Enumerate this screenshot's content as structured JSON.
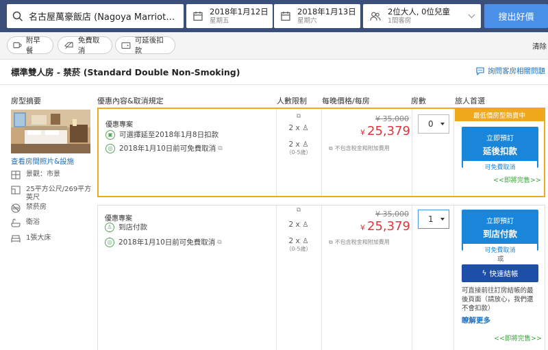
{
  "search": {
    "destination": "名古屋萬豪飯店 (Nagoya Marriott Associa Hotel)",
    "checkin_date": "2018年1月12日",
    "checkin_day": "星期五",
    "checkout_date": "2018年1月13日",
    "checkout_day": "星期六",
    "guests": "2位大人, 0位兒童",
    "rooms": "1間客房",
    "search_button": "搜出好價"
  },
  "filters": {
    "breakfast": "附早餐",
    "free_cancel": "免費取消",
    "pay_later": "可延後扣款",
    "clear": "清除"
  },
  "room": {
    "title": "標準雙人房 - 禁菸 (Standard Double Non-Smoking)",
    "faq_link": "詢問客房相關問題",
    "photo_link": "查看房間照片&設施",
    "features": [
      {
        "icon": "window-icon",
        "text": "景觀：市景"
      },
      {
        "icon": "area-icon",
        "text": "25平方公尺/269平方英尺"
      },
      {
        "icon": "no-smoking-icon",
        "text": "禁菸房"
      },
      {
        "icon": "bath-icon",
        "text": "衛浴"
      },
      {
        "icon": "bed-icon",
        "text": "1張大床"
      }
    ]
  },
  "columns": {
    "summary": "房型摘要",
    "offer": "優惠內容&取消規定",
    "occupancy": "人數限制",
    "price": "每晚價格/每房",
    "rooms": "房數",
    "choice": "旅人首選"
  },
  "offers": [
    {
      "label": "優惠專案",
      "conditions": [
        "可選擇延至2018年1月8日扣款",
        "2018年1月10日前可免費取消"
      ],
      "adults": "2 x",
      "children": "2 x",
      "child_age": "（0-5歲）",
      "original_price": "¥ 35,000",
      "currency": "¥",
      "price": "25,379",
      "tax_note": "不包含稅金和附加費用",
      "quantity": "0",
      "promo": "最低價房型熱賣中",
      "book_line1": "立即預訂",
      "book_line2": "延後扣款",
      "book_line3": "可免費取消",
      "left_note": "<<即將完售>>"
    },
    {
      "label": "優惠專案",
      "conditions": [
        "到店付款",
        "2018年1月10日前可免費取消"
      ],
      "adults": "2 x",
      "children": "2 x",
      "child_age": "（0-5歲）",
      "original_price": "¥ 35,000",
      "currency": "¥",
      "price": "25,379",
      "tax_note": "不包含稅金和附加費用",
      "quantity": "1",
      "book_line1": "立即預訂",
      "book_line2": "到店付款",
      "book_line3": "可免費取消",
      "or_text": "或",
      "quick_checkout": "快速結帳",
      "quick_desc": "可直接前往訂房結帳的最後頁面（請放心，我們還不會扣款）",
      "learn_more": "瞭解更多",
      "left_note": "<<即將完售>>"
    }
  ],
  "colors": {
    "header": "#3a4f7a",
    "accent_blue": "#1a86d9",
    "promo_orange": "#f0a91c",
    "price_red": "#e0333a",
    "green": "#3aa53a"
  }
}
